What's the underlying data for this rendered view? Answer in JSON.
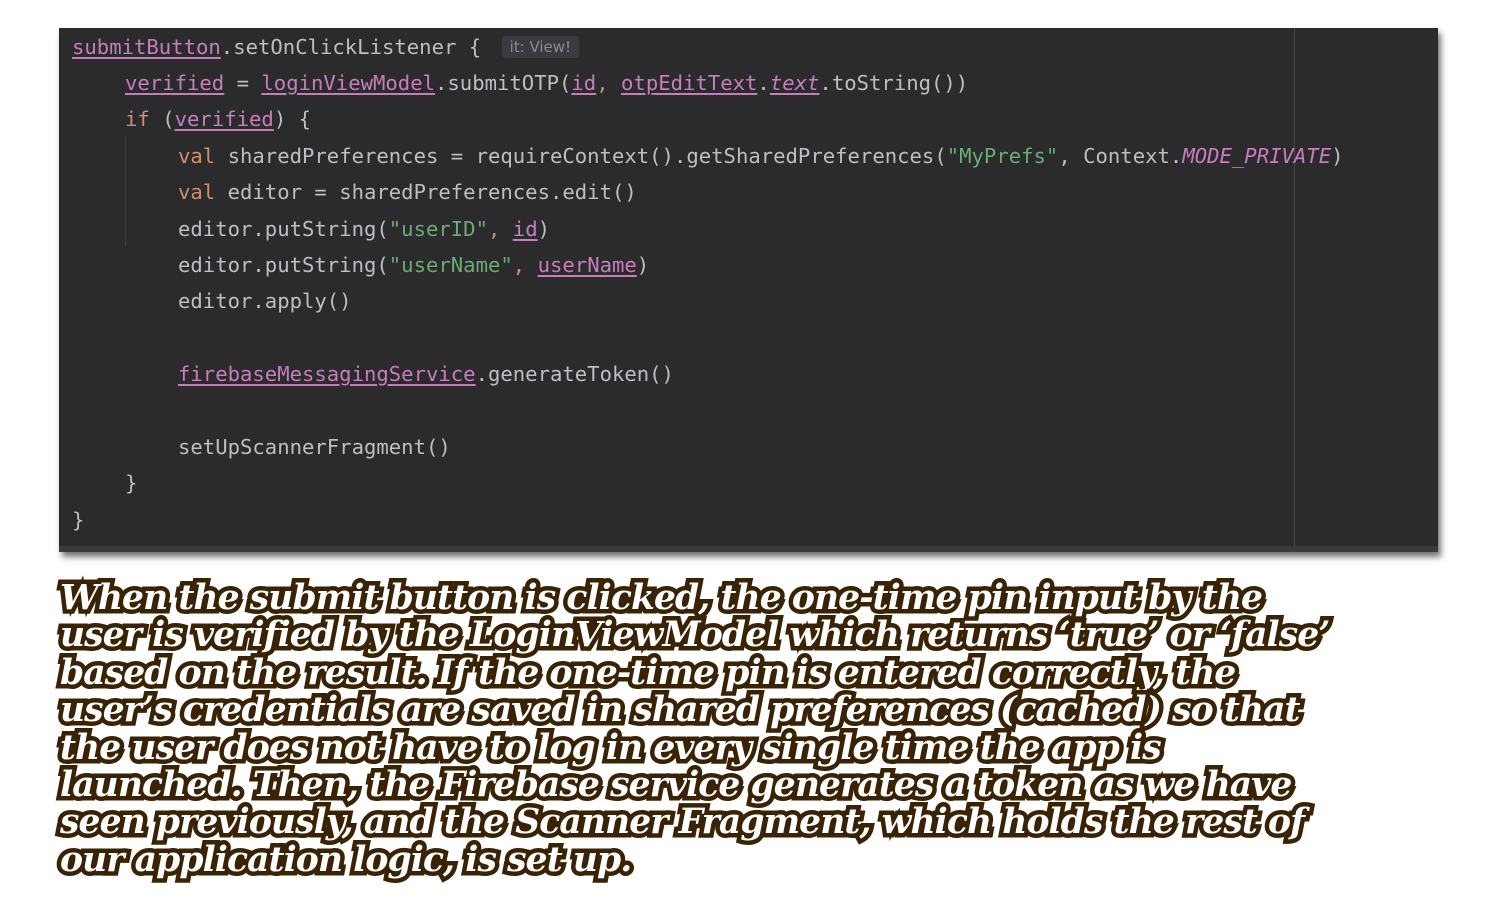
{
  "code_lines": {
    "l1": {
      "a": "submitButton",
      "b": ".setOnClickListener { ",
      "hint": "it: View!"
    },
    "l2": {
      "a": "verified",
      "b": " = ",
      "c": "loginViewModel",
      "d": ".submitOTP(",
      "e": "id",
      "f": ", ",
      "g": "otpEditText",
      "h": ".",
      "i": "text",
      "j": ".toString())"
    },
    "l3": {
      "kw": "if",
      "b": " (",
      "c": "verified",
      "d": ") {"
    },
    "l4": {
      "kw": "val",
      "b": " sharedPreferences = requireContext().getSharedPreferences(",
      "str": "\"MyPrefs\"",
      "c": ", Context.",
      "it": "MODE_PRIVATE",
      "d": ")"
    },
    "l5": {
      "kw": "val",
      "b": " editor = sharedPreferences.edit()"
    },
    "l6": {
      "a": "editor.putString(",
      "str": "\"userID\"",
      "b": ", ",
      "c": "id",
      "d": ")"
    },
    "l7": {
      "a": "editor.putString(",
      "str": "\"userName\"",
      "b": ", ",
      "c": "userName",
      "d": ")"
    },
    "l8": {
      "a": "editor.apply()"
    },
    "l9": {
      "a": "firebaseMessagingService",
      "b": ".generateToken()"
    },
    "l10": {
      "a": "setUpScannerFragment()"
    },
    "l11": {
      "a": "}"
    },
    "l12": {
      "a": "}"
    }
  },
  "caption_lines": [
    "When the submit button is clicked, the one-time pin input by the",
    "user is verified by the LoginViewModel which returns ‘true’ or ‘false’",
    "based on the result. If the one-time pin is entered correctly, the",
    "user’s credentials are saved in shared preferences (cached) so that",
    "the user does not have to log in every single time the app is",
    "launched. Then, the Firebase service generates a token as we have",
    "seen previously, and the Scanner Fragment, which holds the rest of",
    "our application logic, is set up."
  ],
  "colors": {
    "editor_bg": "#2b2b2d",
    "default_text": "#bcbec4",
    "property_purple": "#c77dbb",
    "keyword_orange": "#cf8e6d",
    "string_green": "#6aab73",
    "caption_fill": "#ffffff",
    "caption_outline": "#3a2205"
  }
}
